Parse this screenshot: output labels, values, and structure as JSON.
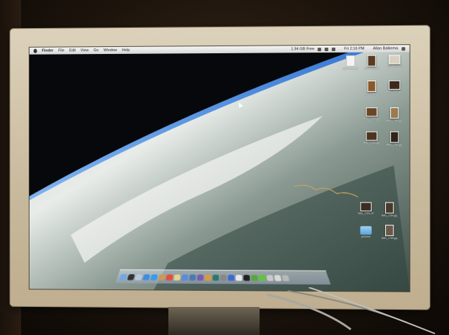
{
  "menubar": {
    "app": "Finder",
    "items": [
      "File",
      "Edit",
      "View",
      "Go",
      "Window",
      "Help"
    ],
    "disk_free": "1.94 GB Free",
    "clock": "Fri 2:16 PM",
    "user": "Allan Balkema"
  },
  "desktop_icons": [
    {
      "label": "Add to Gallery",
      "kind": "document"
    },
    {
      "label": "IMG_1758.jpg",
      "kind": "photo"
    },
    {
      "label": "google_search",
      "kind": "photo"
    },
    {
      "label": "IMG_1756.jpg",
      "kind": "photo"
    },
    {
      "label": "IMG_1757.jpg",
      "kind": "photo"
    },
    {
      "label": "IMG_1759.jpg",
      "kind": "photo"
    },
    {
      "label": "IMG_1760.jpg",
      "kind": "photo"
    },
    {
      "label": "IMG_1761.jpg",
      "kind": "photo"
    },
    {
      "label": "IMG_1762.jpg",
      "kind": "photo"
    },
    {
      "label": "IMG_1763.JPG",
      "kind": "photo"
    },
    {
      "label": "IMG_1764.jpg",
      "kind": "photo"
    },
    {
      "label": "pictures",
      "kind": "folder"
    },
    {
      "label": "IMG_1765.jpg",
      "kind": "photo"
    }
  ],
  "colors": {
    "sky": "#0a0b0f",
    "atmosphere": "#4c8fd8",
    "cloud": "#e9ece9",
    "ocean": "#2d3e3a",
    "bezel": "#dcd1ba"
  },
  "dock_icons": [
    "finder-icon",
    "dashboard-icon",
    "mail-icon",
    "safari-icon",
    "ichat-icon",
    "addressbook-icon",
    "ical-icon",
    "preview-icon",
    "itunes-icon",
    "iphoto-icon",
    "imovie-icon",
    "garageband-icon",
    "timemachine-icon",
    "systemprefs-icon",
    "appstore-icon",
    "textedit-icon",
    "terminal-icon",
    "utility-icon",
    "activity-icon",
    "downloads-stack-icon",
    "documents-stack-icon",
    "trash-icon"
  ]
}
